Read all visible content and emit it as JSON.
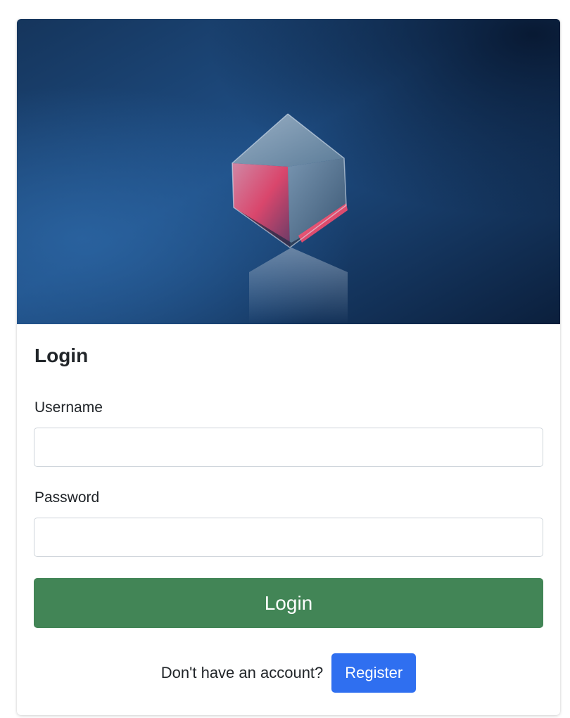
{
  "hero": {
    "image": "crystal-cube-image"
  },
  "form": {
    "title": "Login",
    "username_label": "Username",
    "username_value": "",
    "password_label": "Password",
    "password_value": "",
    "login_label": "Login"
  },
  "footer": {
    "prompt": "Don't have an account?",
    "register_label": "Register"
  },
  "colors": {
    "login_button": "#428556",
    "register_button": "#2f6ff0"
  }
}
